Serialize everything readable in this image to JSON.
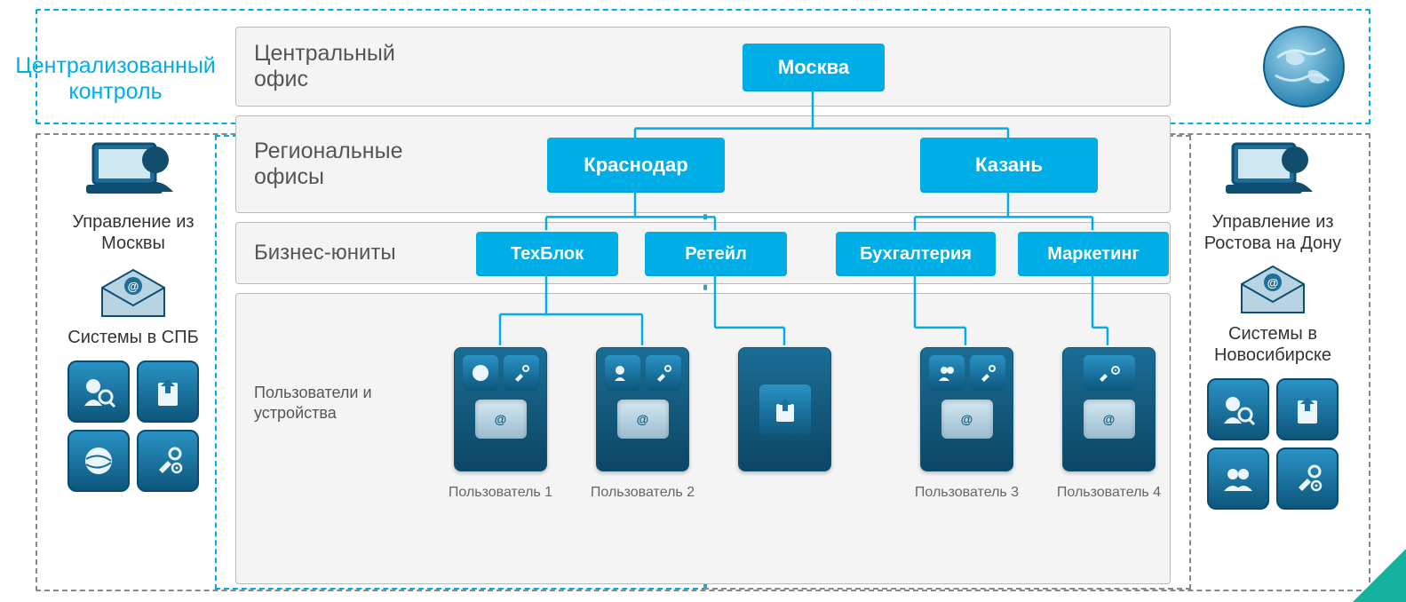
{
  "cc_label": "Централизованный контроль",
  "rows": {
    "central": {
      "label": "Центральный офис",
      "hq": "Москва"
    },
    "regional": {
      "label": "Региональные офисы",
      "offices": [
        "Краснодар",
        "Казань"
      ]
    },
    "bu": {
      "label": "Бизнес-юниты",
      "units": [
        "ТехБлок",
        "Ретейл",
        "Бухгалтерия",
        "Маркетинг"
      ]
    },
    "users": {
      "label": "Пользователи и устройства",
      "captions": [
        "Пользователь 1",
        "Пользователь 2",
        "Пользователь 3",
        "Пользователь 4"
      ]
    }
  },
  "left": {
    "manage": "Управление из Москвы",
    "systems": "Системы в СПБ"
  },
  "right": {
    "manage": "Управление из Ростова на Дону",
    "systems": "Системы в Новосибирске"
  },
  "chart_data": {
    "type": "diagram",
    "title": "Централизованный контроль — организационная структура",
    "hierarchy": {
      "name": "Москва",
      "role": "Центральный офис",
      "children": [
        {
          "name": "Краснодар",
          "role": "Региональный офис",
          "children": [
            {
              "name": "ТехБлок",
              "role": "Бизнес-юнит",
              "children": [
                {
                  "name": "Пользователь 1",
                  "role": "Пользователь/устройство"
                }
              ]
            },
            {
              "name": "Ретейл",
              "role": "Бизнес-юнит",
              "children": [
                {
                  "name": "Пользователь 2",
                  "role": "Пользователь/устройство"
                }
              ]
            }
          ]
        },
        {
          "name": "Казань",
          "role": "Региональный офис",
          "children": [
            {
              "name": "Бухгалтерия",
              "role": "Бизнес-юнит",
              "children": [
                {
                  "name": "Пользователь 3",
                  "role": "Пользователь/устройство"
                }
              ]
            },
            {
              "name": "Маркетинг",
              "role": "Бизнес-юнит",
              "children": [
                {
                  "name": "Пользователь 4",
                  "role": "Пользователь/устройство"
                }
              ]
            }
          ]
        }
      ]
    },
    "side_annotations": {
      "left": [
        "Управление из Москвы",
        "Системы в СПБ"
      ],
      "right": [
        "Управление из Ростова на Дону",
        "Системы в Новосибирске"
      ]
    }
  }
}
